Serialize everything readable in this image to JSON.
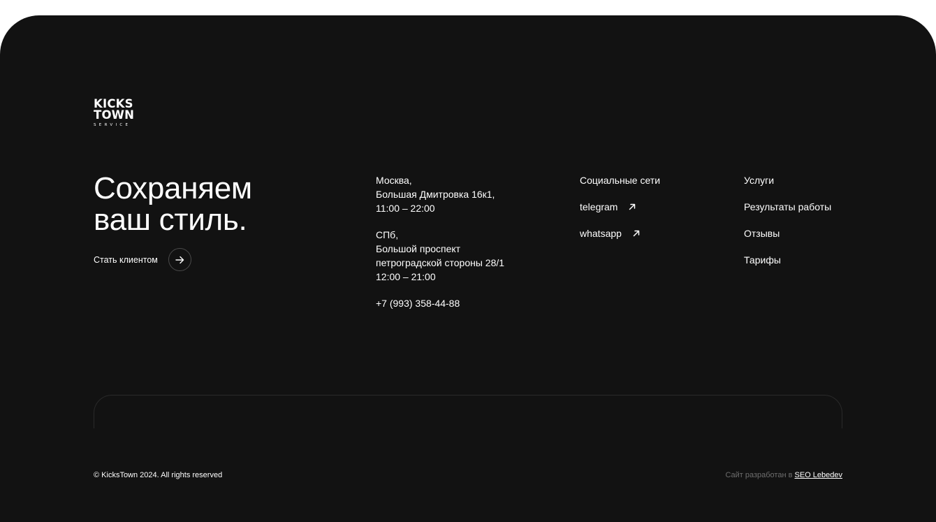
{
  "logo": {
    "line1": "KICKS",
    "line2": "TOWN",
    "line3": "SERVICE"
  },
  "hero": {
    "headline_line1": "Сохраняем",
    "headline_line2": "ваш стиль.",
    "cta_label": "Стать клиентом",
    "cta_icon": "arrow-right-icon"
  },
  "contacts": {
    "moscow": {
      "city": "Москва,",
      "address": "Большая Дмитровка 16к1,",
      "hours": "11:00 – 22:00"
    },
    "spb": {
      "city": "СПб,",
      "address_line1": "Большой проспект",
      "address_line2": "петроградской стороны 28/1",
      "hours": "12:00 – 21:00"
    },
    "phone": "+7 (993) 358-44-88"
  },
  "social": {
    "title": "Социальные сети",
    "links": [
      {
        "label": "telegram",
        "icon": "arrow-up-right-icon"
      },
      {
        "label": "whatsapp",
        "icon": "arrow-up-right-icon"
      }
    ]
  },
  "menu": {
    "items": [
      "Услуги",
      "Результаты работы",
      "Отзывы",
      "Тарифы"
    ]
  },
  "bottom": {
    "copyright": "© KicksTown 2024. All rights reserved",
    "developed_prefix": "Сайт разработан в",
    "developer_link": "SEO Lebedev"
  },
  "colors": {
    "background": "#121212",
    "text": "#ffffff",
    "muted": "#6e6e6e"
  }
}
